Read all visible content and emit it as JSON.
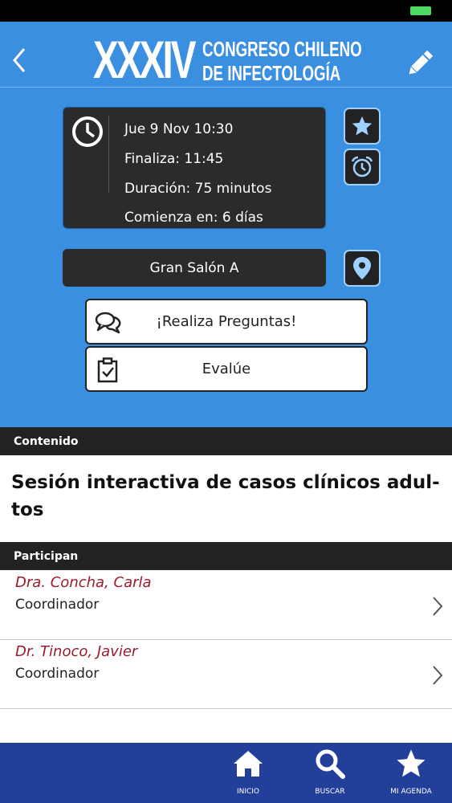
{
  "header": {
    "title_roman": "XXXIV",
    "title_line1": "CONGRESO CHILENO",
    "title_line2": "DE INFECTOLOGÍA",
    "back_icon": "chevron-left-icon",
    "edit_icon": "pencil-icon"
  },
  "schedule": {
    "date_time": "Jue 9  Nov  10:30",
    "ends": "Finaliza: 11:45",
    "duration": "Duración: 75 minutos",
    "starts_in": "Comienza en: 6 días",
    "clock_icon": "clock-icon",
    "favorite_icon": "star-icon",
    "alarm_icon": "alarm-icon"
  },
  "location": {
    "room": "Gran Salón A",
    "map_icon": "map-pin-icon"
  },
  "actions": {
    "questions_label": "¡Realiza Preguntas!",
    "evaluate_label": "Evalúe"
  },
  "content": {
    "section_label": "Contenido",
    "title": "Sesión interactiva de casos clínicos adul-tos"
  },
  "participants": {
    "section_label": "Participan",
    "items": [
      {
        "name": "Dra. Concha, Carla",
        "role": "Coordinador"
      },
      {
        "name": "Dr. Tinoco, Javier",
        "role": "Coordinador"
      }
    ]
  },
  "tabbar": {
    "items": [
      {
        "label": "INICIO",
        "icon": "home-icon"
      },
      {
        "label": "BUSCAR",
        "icon": "search-icon"
      },
      {
        "label": "MI AGENDA",
        "icon": "star-icon"
      }
    ]
  },
  "colors": {
    "hero_bg": "#3b8fe0",
    "dark_box": "#2b2b2b",
    "participant_name": "#9b1b2b",
    "tabbar_bg": "#22409a"
  }
}
